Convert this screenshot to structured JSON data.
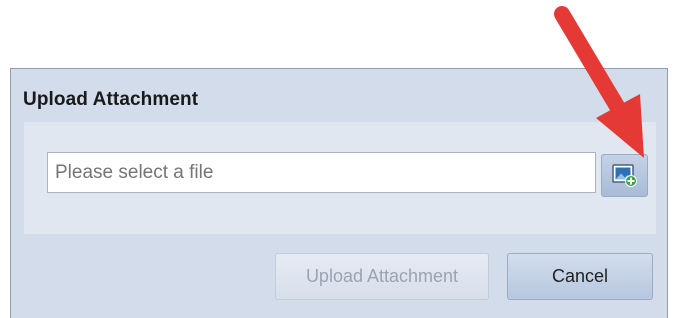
{
  "dialog": {
    "title": "Upload Attachment",
    "file_input": {
      "value": "",
      "placeholder": "Please select a file"
    },
    "browse_button_icon": "image-add-icon",
    "buttons": {
      "upload_label": "Upload Attachment",
      "upload_enabled": false,
      "cancel_label": "Cancel"
    }
  },
  "annotation": {
    "icon": "red-arrow-icon",
    "color": "#e53935"
  },
  "colors": {
    "dialog_background": "#d2dceb",
    "panel_background": "#e1e7f1",
    "button_background": "#b7c7df"
  }
}
